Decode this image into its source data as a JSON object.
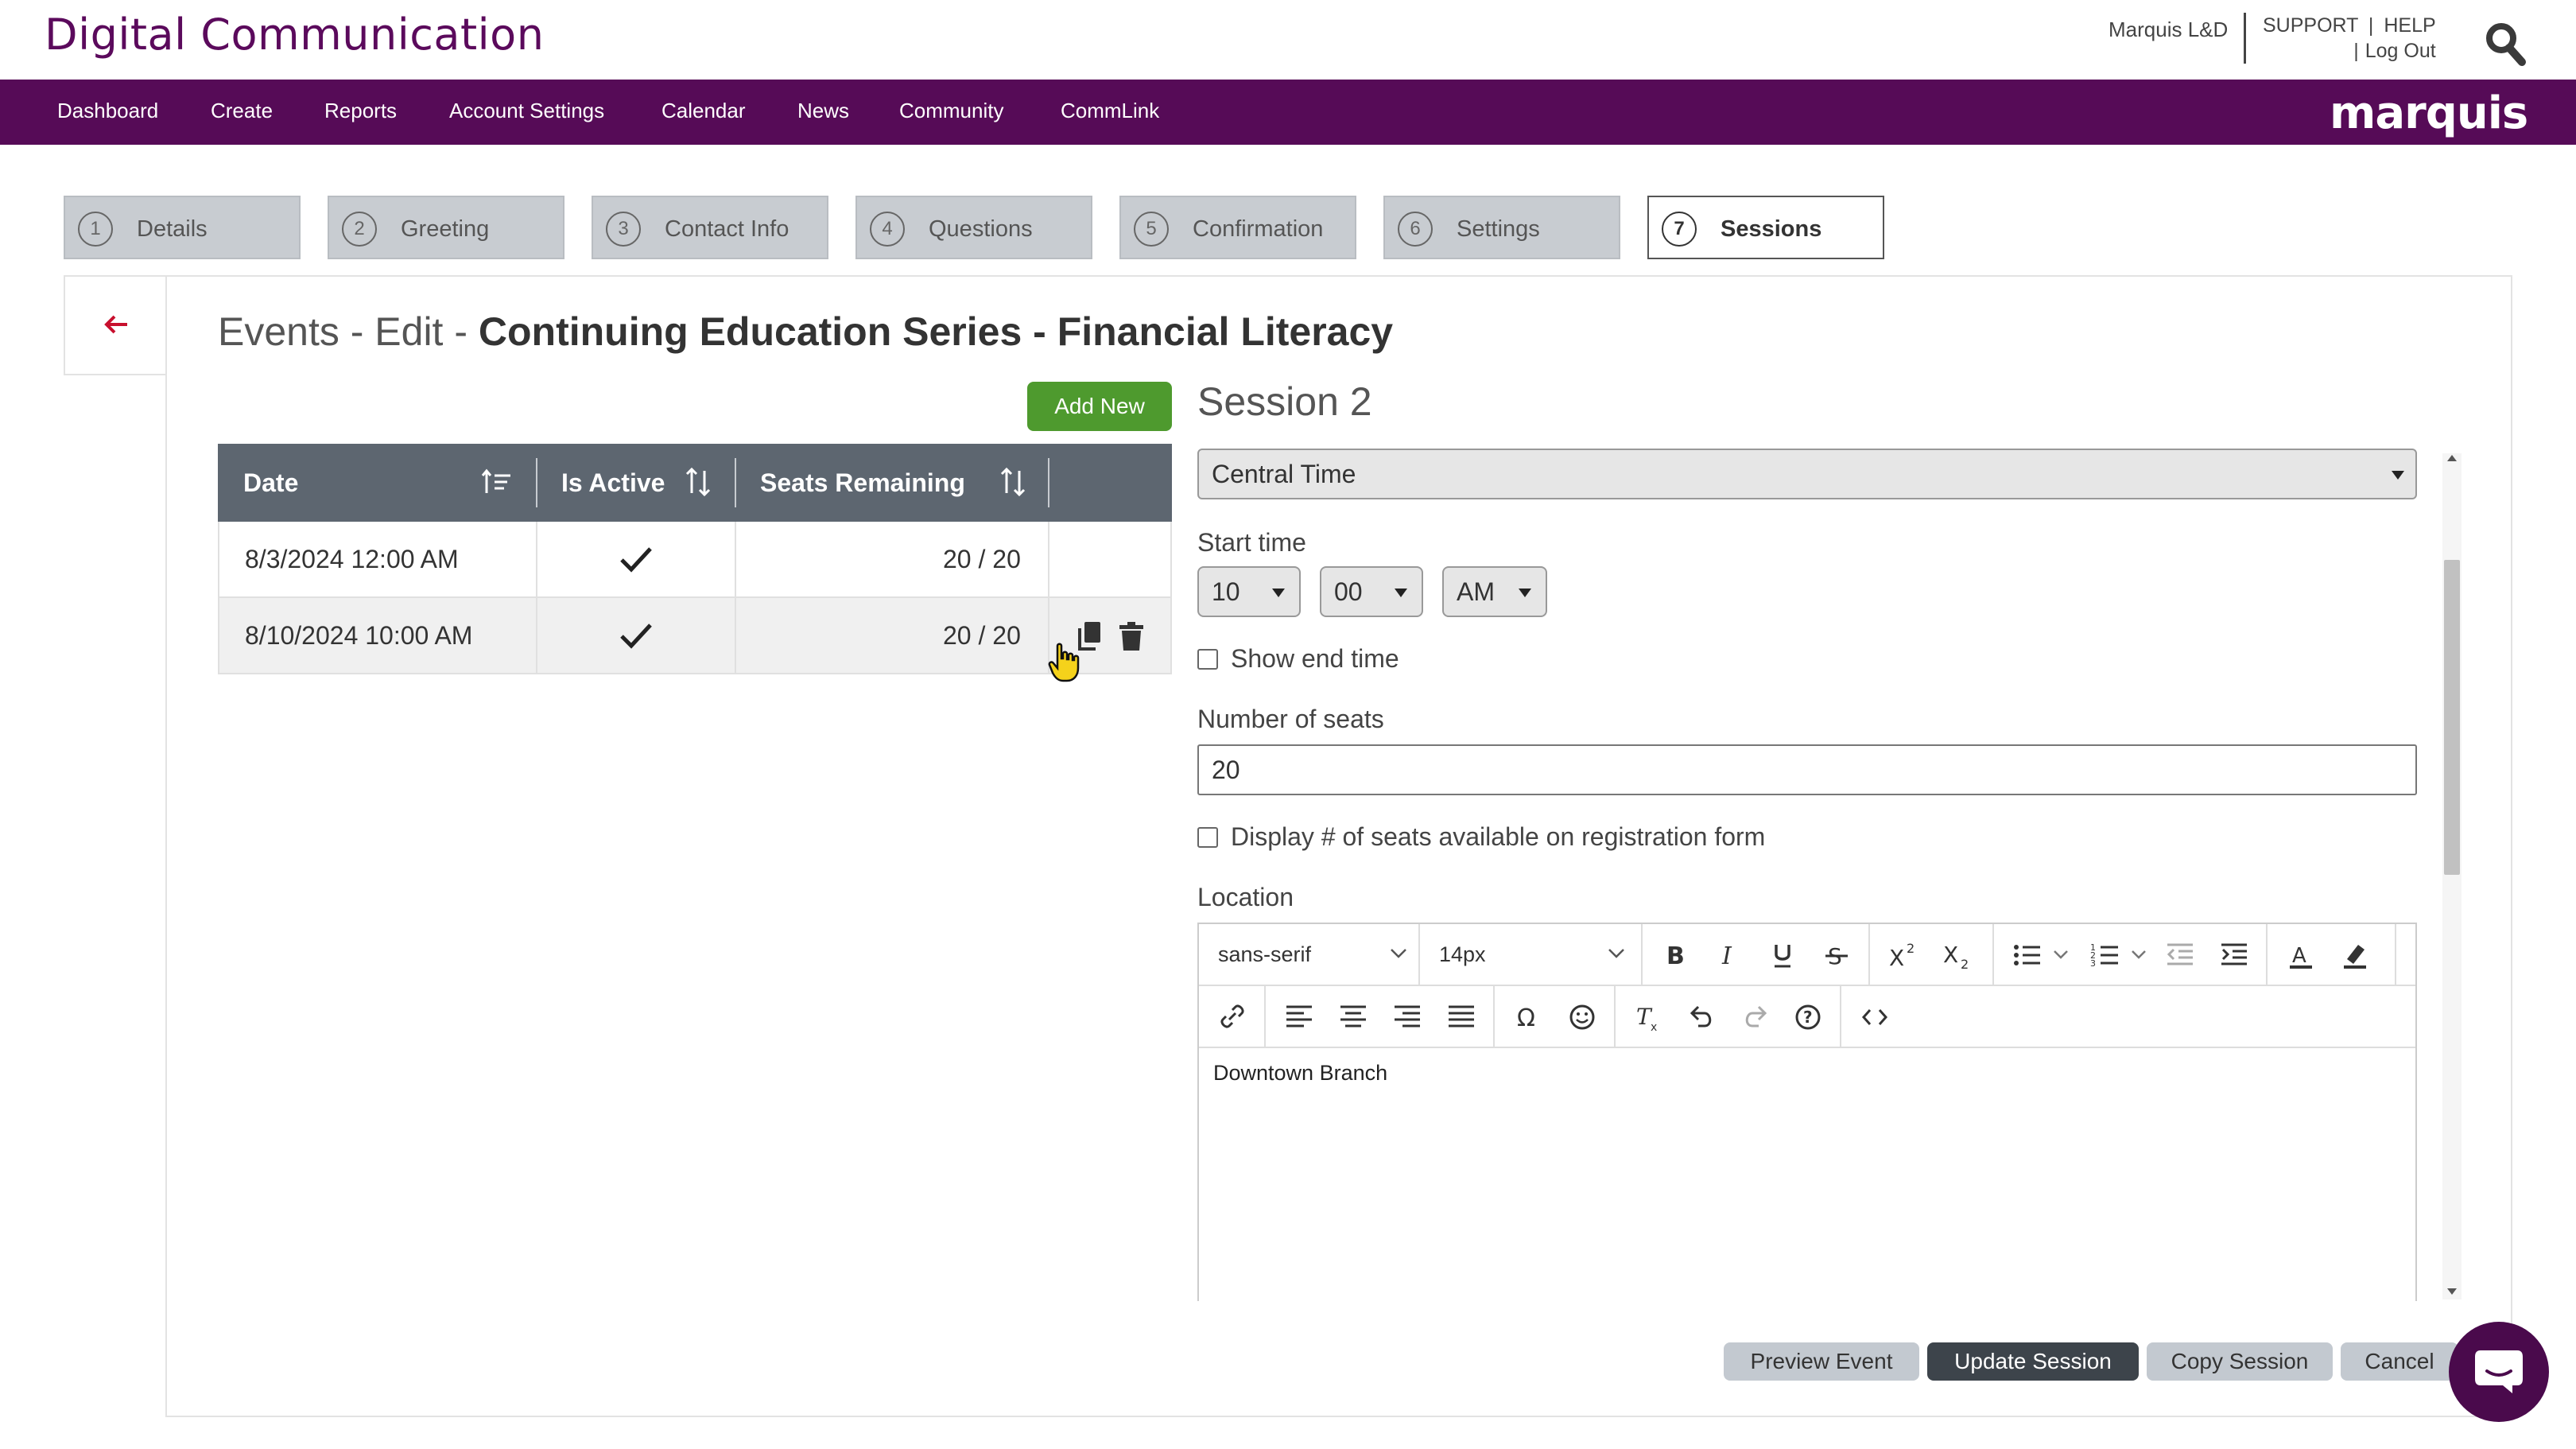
{
  "header": {
    "brand": "Digital Communication",
    "org_name": "Marquis L&D",
    "support": "SUPPORT",
    "help": "HELP",
    "link_separator": "|",
    "log_out": "Log Out",
    "logo_text": "marquis"
  },
  "nav": [
    {
      "label": "Dashboard"
    },
    {
      "label": "Create"
    },
    {
      "label": "Reports"
    },
    {
      "label": "Account Settings"
    },
    {
      "label": "Calendar"
    },
    {
      "label": "News"
    },
    {
      "label": "Community"
    },
    {
      "label": "CommLink"
    }
  ],
  "steps": [
    {
      "num": "1",
      "label": "Details"
    },
    {
      "num": "2",
      "label": "Greeting"
    },
    {
      "num": "3",
      "label": "Contact Info"
    },
    {
      "num": "4",
      "label": "Questions"
    },
    {
      "num": "5",
      "label": "Confirmation"
    },
    {
      "num": "6",
      "label": "Settings"
    },
    {
      "num": "7",
      "label": "Sessions",
      "active": true
    }
  ],
  "page": {
    "title_prefix": "Events - Edit - ",
    "title_bold": "Continuing Education Series - Financial Literacy"
  },
  "sessions_table": {
    "add_new_label": "Add New",
    "headers": [
      "Date",
      "Is Active",
      "Seats Remaining"
    ],
    "rows": [
      {
        "date": "8/3/2024 12:00 AM",
        "active": true,
        "seats": "20 / 20"
      },
      {
        "date": "8/10/2024 10:00 AM",
        "active": true,
        "seats": "20 / 20"
      }
    ]
  },
  "session_form": {
    "title": "Session 2",
    "timezone": "Central Time",
    "start_time_label": "Start time",
    "hour": "10",
    "minute": "00",
    "ampm": "AM",
    "show_end_time_label": "Show end time",
    "show_end_time_checked": false,
    "seats_label": "Number of seats",
    "seats_value": "20",
    "display_seats_label": "Display # of seats available on registration form",
    "display_seats_checked": false,
    "location_label": "Location",
    "editor": {
      "font_family": "sans-serif",
      "font_size": "14px",
      "content": "Downtown Branch"
    }
  },
  "actions": {
    "preview": "Preview Event",
    "update": "Update Session",
    "copy": "Copy Session",
    "cancel": "Cancel"
  },
  "colors": {
    "brand_purple": "#560b57",
    "add_green": "#4e9a2e",
    "table_header": "#5d6670",
    "back_arrow_red": "#c8102e"
  }
}
